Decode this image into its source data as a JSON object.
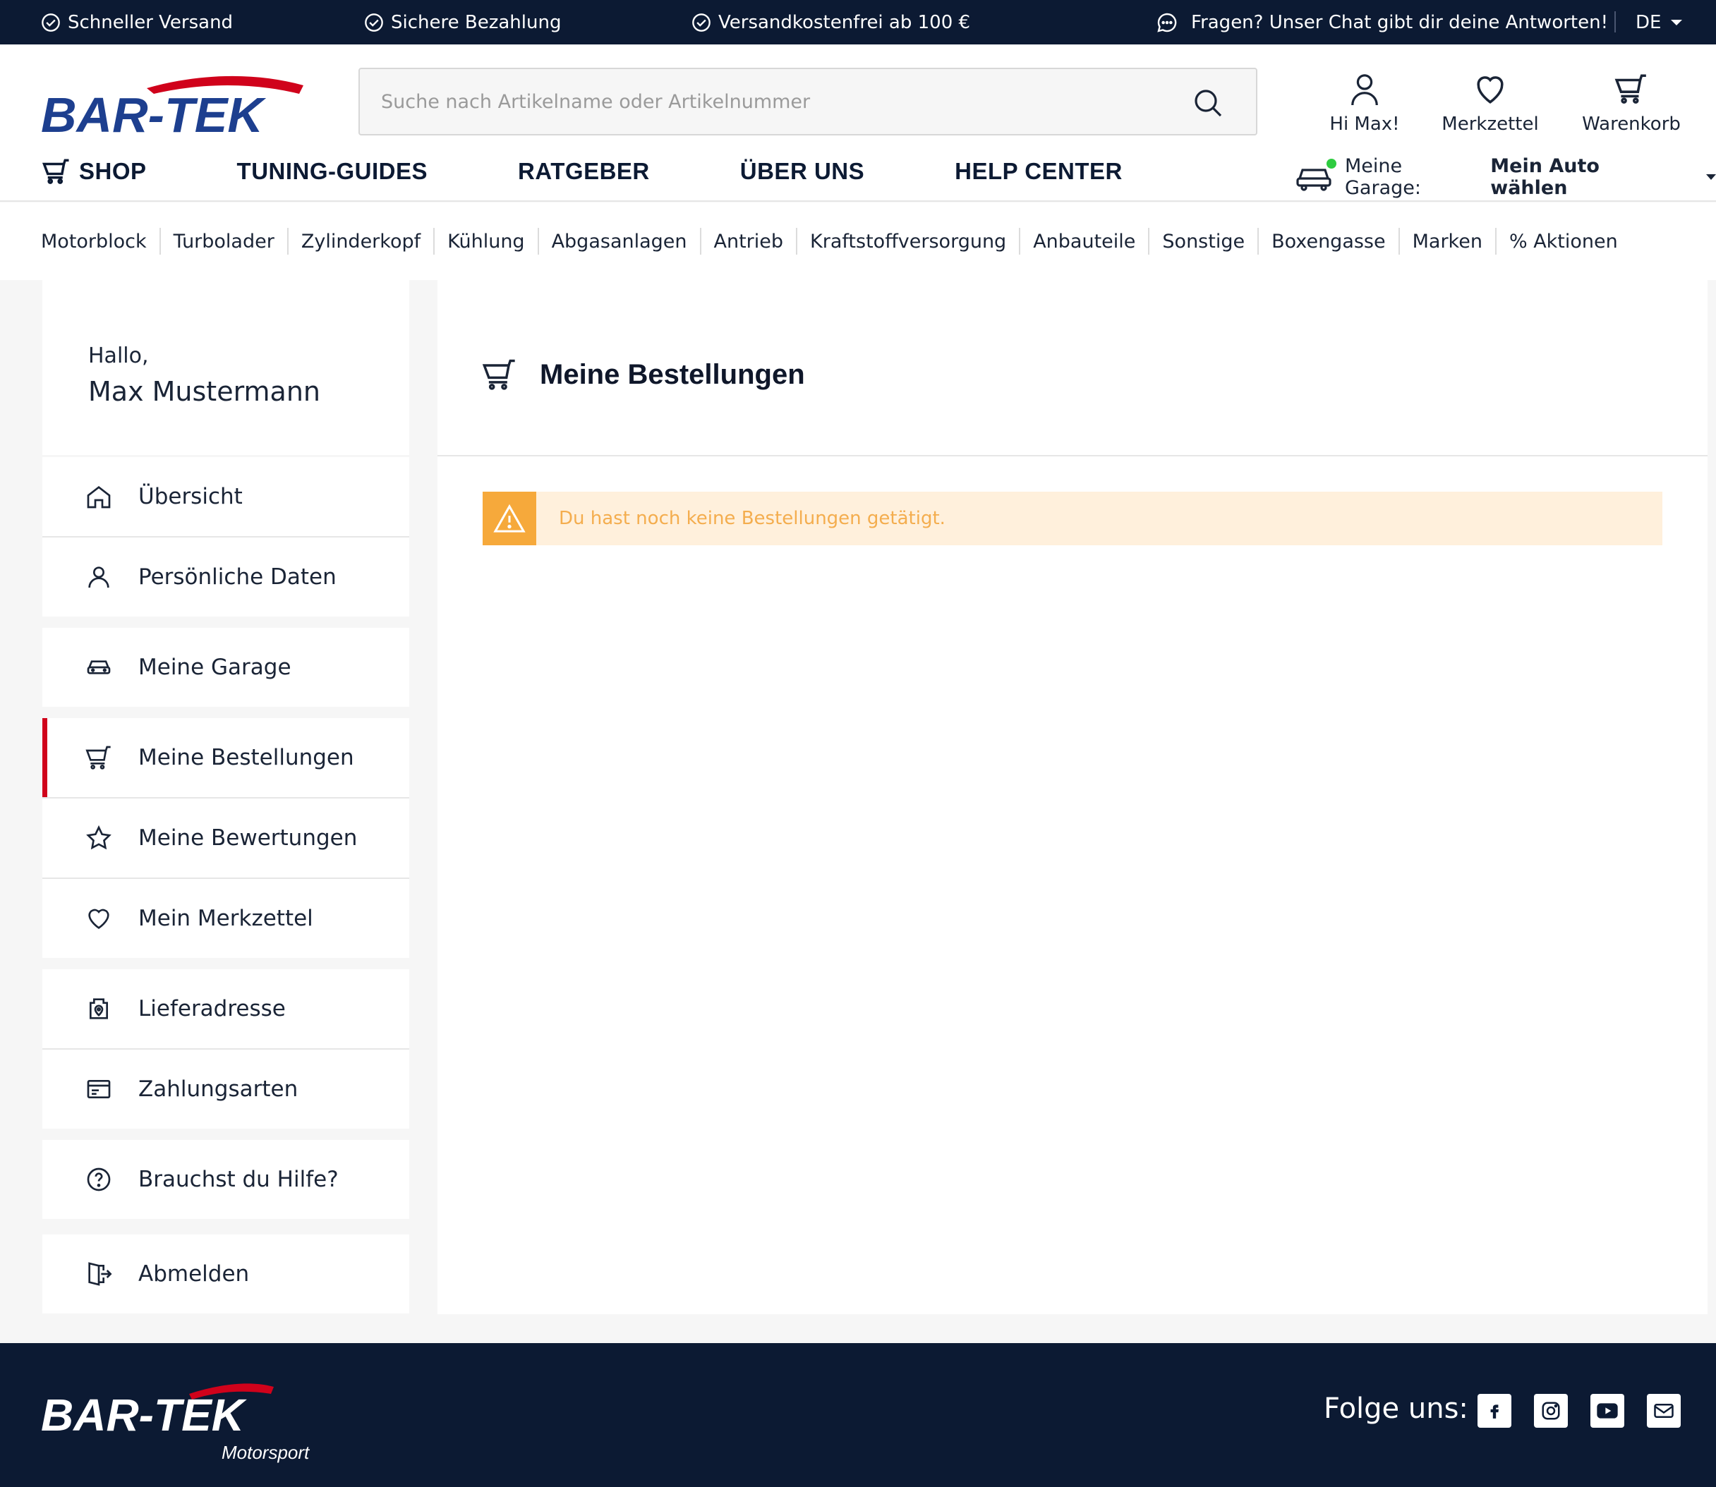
{
  "topbar": {
    "usp1": "Schneller Versand",
    "usp2": "Sichere Bezahlung",
    "usp3": "Versandkostenfrei ab 100 €",
    "chat": "Fragen? Unser Chat gibt dir deine Antworten!",
    "lang": "DE"
  },
  "header": {
    "logo_text": "BAR-TEK",
    "search_placeholder": "Suche nach Artikelname oder Artikelnummer",
    "account_label": "Hi Max!",
    "wishlist_label": "Merkzettel",
    "cart_label": "Warenkorb"
  },
  "mainnav": {
    "shop": "SHOP",
    "tuning": "TUNING-GUIDES",
    "ratgeber": "RATGEBER",
    "ueber": "ÜBER UNS",
    "help": "HELP CENTER"
  },
  "garage": {
    "label": "Meine Garage:",
    "value": "Mein Auto wählen"
  },
  "categories": [
    "Motorblock",
    "Turbolader",
    "Zylinderkopf",
    "Kühlung",
    "Abgasanlagen",
    "Antrieb",
    "Kraftstoffversorgung",
    "Anbauteile",
    "Sonstige",
    "Boxengasse",
    "Marken",
    "% Aktionen"
  ],
  "sidebar": {
    "greeting": "Hallo,",
    "user_name": "Max Mustermann",
    "overview": "Übersicht",
    "personal": "Persönliche Daten",
    "garage": "Meine Garage",
    "orders": "Meine Bestellungen",
    "reviews": "Meine Bewertungen",
    "wishlist": "Mein Merkzettel",
    "address": "Lieferadresse",
    "payment": "Zahlungsarten",
    "help": "Brauchst du Hilfe?",
    "logout": "Abmelden"
  },
  "main": {
    "title": "Meine Bestellungen",
    "alert_text": "Du hast noch keine Bestellungen getätigt."
  },
  "footer": {
    "logo_text": "BAR-TEK",
    "logo_sub": "Motorsport",
    "follow": "Folge uns:"
  },
  "colors": {
    "navy": "#0c1a33",
    "accent_red": "#d0021b",
    "logo_blue": "#1d3f8f",
    "warning_bg": "#fff0dc",
    "warning_icon_bg": "#f6a93b",
    "warning_text": "#f4ad4e"
  }
}
